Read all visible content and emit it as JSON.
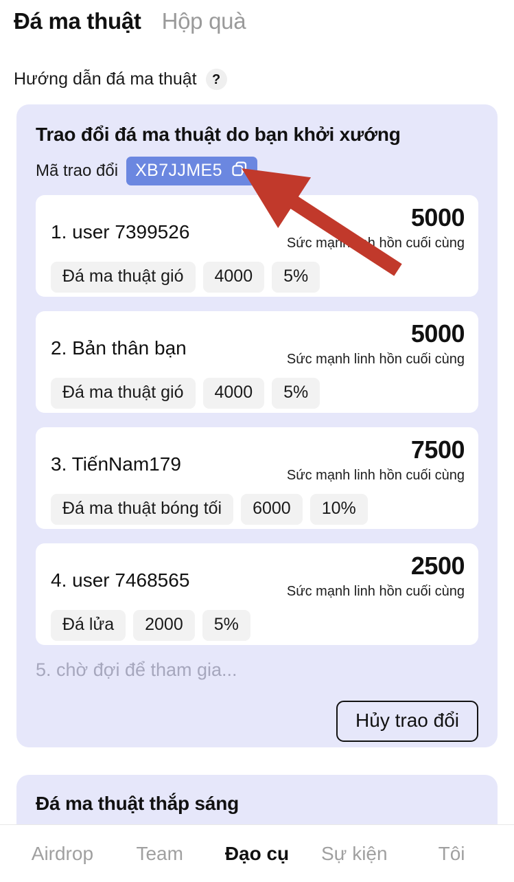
{
  "header": {
    "tabs": [
      {
        "label": "Đá ma thuật",
        "active": true
      },
      {
        "label": "Hộp quà",
        "active": false
      }
    ]
  },
  "guide": {
    "text": "Hướng dẫn đá ma thuật",
    "help_icon": "question-mark-icon",
    "help_glyph": "?"
  },
  "exchange_panel": {
    "title": "Trao đổi đá ma thuật do bạn khởi xướng",
    "code_label": "Mã trao đổi",
    "code_value": "XB7JJME5",
    "copy_icon": "copy-icon",
    "power_label": "Sức mạnh linh hồn cuối cùng",
    "participants": [
      {
        "name": "1. user 7399526",
        "power": "5000",
        "power_label": "Sức mạnh linh hồn cuối cùng",
        "chips": [
          "Đá ma thuật gió",
          "4000",
          "5%"
        ]
      },
      {
        "name": "2. Bản thân bạn",
        "power": "5000",
        "power_label": "Sức mạnh linh hồn cuối cùng",
        "chips": [
          "Đá ma thuật gió",
          "4000",
          "5%"
        ]
      },
      {
        "name": "3. TiếnNam179",
        "power": "7500",
        "power_label": "Sức mạnh linh hồn cuối cùng",
        "chips": [
          "Đá ma thuật bóng tối",
          "6000",
          "10%"
        ]
      },
      {
        "name": "4. user 7468565",
        "power": "2500",
        "power_label": "Sức mạnh linh hồn cuối cùng",
        "chips": [
          "Đá lửa",
          "2000",
          "5%"
        ]
      }
    ],
    "waiting_text": "5. chờ đợi để tham gia...",
    "cancel_label": "Hủy trao đổi"
  },
  "lighting_panel": {
    "title": "Đá ma thuật thắp sáng"
  },
  "annotation": {
    "arrow_color": "#c1392b",
    "points_to": "copy-icon"
  },
  "bottom_nav": {
    "items": [
      {
        "label": "Airdrop",
        "active": false
      },
      {
        "label": "Team",
        "active": false
      },
      {
        "label": "Đạo cụ",
        "active": true
      },
      {
        "label": "Sự kiện",
        "active": false
      },
      {
        "label": "Tôi",
        "active": false
      }
    ]
  },
  "colors": {
    "panel_bg": "#e6e7fa",
    "card_bg": "#ffffff",
    "chip_bg": "#f2f2f2",
    "code_chip_bg": "#6b87e0",
    "accent_red": "#c1392b",
    "muted_text": "#a0a0a0"
  }
}
